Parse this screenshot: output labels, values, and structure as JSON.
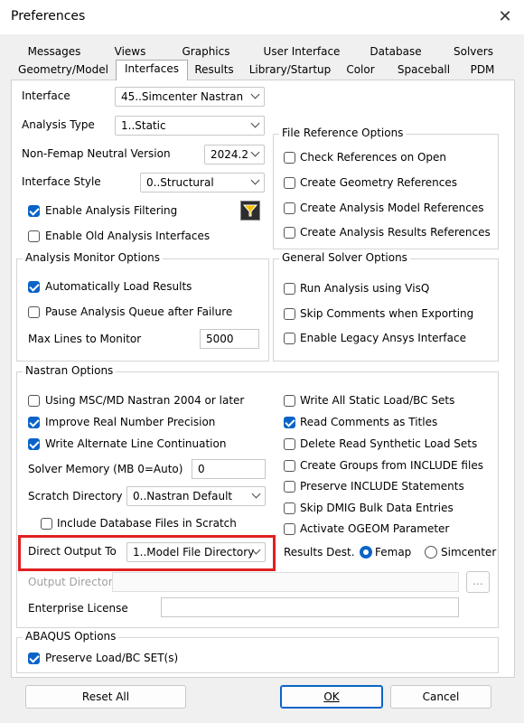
{
  "window": {
    "title": "Preferences"
  },
  "tabs": {
    "row1": [
      "Messages",
      "Views",
      "Graphics",
      "User Interface",
      "Database",
      "Solvers"
    ],
    "row2": [
      "Geometry/Model",
      "Interfaces",
      "Results",
      "Library/Startup",
      "Color",
      "Spaceball",
      "PDM"
    ],
    "active": "Interfaces"
  },
  "interface": {
    "interface_label": "Interface",
    "interface_value": "45..Simcenter Nastran",
    "analysis_type_label": "Analysis Type",
    "analysis_type_value": "1..Static",
    "nonfemap_label": "Non-Femap Neutral Version",
    "nonfemap_value": "2024.2",
    "style_label": "Interface Style",
    "style_value": "0..Structural",
    "enable_filtering": "Enable Analysis Filtering",
    "enable_old": "Enable Old Analysis Interfaces"
  },
  "file_ref": {
    "title": "File Reference Options",
    "check": "Check References on Open",
    "geometry": "Create Geometry References",
    "analysis_model": "Create Analysis Model References",
    "analysis_results": "Create Analysis Results References"
  },
  "monitor": {
    "title": "Analysis Monitor Options",
    "auto_load": "Automatically Load Results",
    "pause": "Pause Analysis Queue after Failure",
    "max_lines_label": "Max Lines to Monitor",
    "max_lines_value": "5000"
  },
  "general": {
    "title": "General Solver Options",
    "visq": "Run Analysis using VisQ",
    "skip_comments": "Skip Comments when Exporting",
    "legacy_ansys": "Enable Legacy Ansys Interface"
  },
  "nastran": {
    "title": "Nastran Options",
    "msc2004": "Using MSC/MD Nastran 2004 or later",
    "improve_real": "Improve Real Number Precision",
    "alt_line": "Write Alternate Line Continuation",
    "solver_mem_label": "Solver Memory (MB 0=Auto)",
    "solver_mem_value": "0",
    "scratch_label": "Scratch Directory",
    "scratch_value": "0..Nastran Default",
    "include_db": "Include Database Files in Scratch",
    "direct_out_label": "Direct Output To",
    "direct_out_value": "1..Model File Directory",
    "output_dir_label": "Output Directory",
    "output_dir_btn": "...",
    "enterprise_label": "Enterprise License",
    "write_all": "Write All Static Load/BC Sets",
    "read_comments": "Read Comments as Titles",
    "delete_synth": "Delete Read Synthetic Load Sets",
    "create_groups": "Create Groups from INCLUDE files",
    "preserve_include": "Preserve INCLUDE Statements",
    "skip_dmig": "Skip DMIG Bulk Data Entries",
    "activate_ogeom": "Activate OGEOM Parameter",
    "results_dest_label": "Results Dest.",
    "results_femap": "Femap",
    "results_simcenter": "Simcenter"
  },
  "abaqus": {
    "title": "ABAQUS Options",
    "preserve": "Preserve Load/BC SET(s)"
  },
  "buttons": {
    "reset": "Reset All",
    "ok": "OK",
    "cancel": "Cancel"
  }
}
